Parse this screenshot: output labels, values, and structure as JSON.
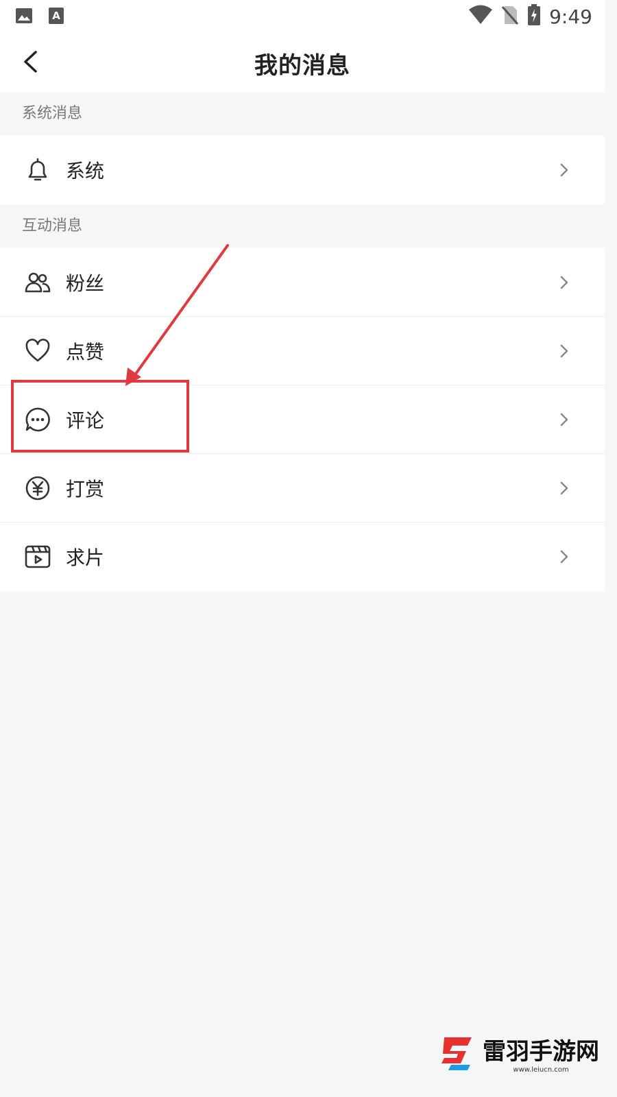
{
  "status_bar": {
    "time": "9:49",
    "left_icons": [
      "image-icon",
      "font-icon"
    ],
    "right_icons": [
      "wifi-icon",
      "no-sim-icon",
      "battery-charging-icon"
    ]
  },
  "header": {
    "title": "我的消息",
    "back_icon": "back-arrow-icon"
  },
  "sections": [
    {
      "title": "系统消息",
      "items": [
        {
          "label": "系统",
          "icon": "bell-icon"
        }
      ]
    },
    {
      "title": "互动消息",
      "items": [
        {
          "label": "粉丝",
          "icon": "users-icon"
        },
        {
          "label": "点赞",
          "icon": "heart-icon"
        },
        {
          "label": "评论",
          "icon": "comment-icon"
        },
        {
          "label": "打赏",
          "icon": "yen-icon"
        },
        {
          "label": "求片",
          "icon": "video-icon"
        }
      ]
    }
  ],
  "annotation": {
    "highlighted_item": "评论",
    "color": "#e03a3e"
  },
  "watermark": {
    "text": "雷羽手游网",
    "url_text": "www.leiucn.com"
  },
  "colors": {
    "background": "#f5f6f6",
    "surface": "#ffffff",
    "text": "#222222",
    "section_text": "#777777"
  }
}
